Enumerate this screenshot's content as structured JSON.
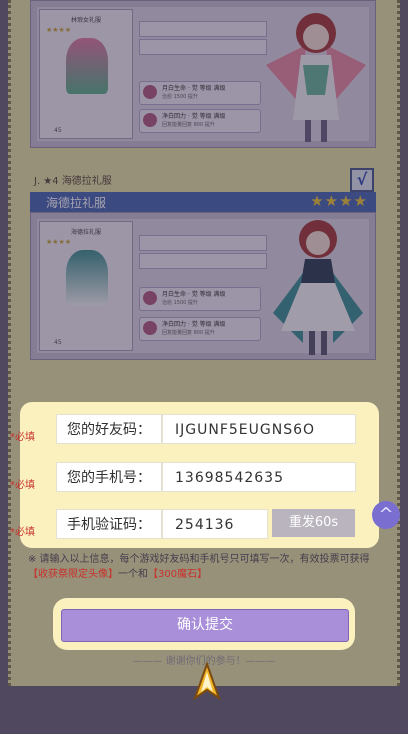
{
  "card1": {
    "outfit_label": "林琅女礼服",
    "skill_1": "月白生命 · 觉 等级 满级",
    "skill_1_desc": "治愈 1500 提升",
    "skill_2": "净白回力 · 觉 等级 满级",
    "skill_2_desc": "回复能量回复 800 提升",
    "level_text": "45"
  },
  "card2": {
    "header": "J. ★4 海德拉礼服",
    "check_mark": "√",
    "banner_title": "海德拉礼服",
    "banner_stars": "★★★★",
    "outfit_label": "海德拉礼服",
    "skill_1": "月白生命 · 觉 等级 满级",
    "skill_1_desc": "治愈 1500 提升",
    "skill_2": "净白回力 · 觉 等级 满级",
    "skill_2_desc": "回复能量回复 800 提升",
    "level_text": "45"
  },
  "form": {
    "required": "*必填",
    "friend_code_label": "您的好友码：",
    "friend_code_value": "IJGUNF5EUGNS6O",
    "phone_label": "您的手机号：",
    "phone_value": "13698542635",
    "verify_label": "手机验证码：",
    "verify_value": "254136",
    "resend_label": "重发60s"
  },
  "note": {
    "prefix": "※ 请输入以上信息，每个游戏好友码和手机号只可填写一次，有效投票可获得",
    "reward1": "【收获祭限定头像】",
    "mid": "一个和",
    "reward2": "【300魔石】"
  },
  "submit_label": "确认提交",
  "thanks": "——— 谢谢你们的参与！———",
  "scroll_top_icon": "^",
  "colors": {
    "accent": "#a98fd9",
    "banner": "#4a68b5",
    "required": "#c8312b",
    "panel": "#fbf1bf"
  }
}
